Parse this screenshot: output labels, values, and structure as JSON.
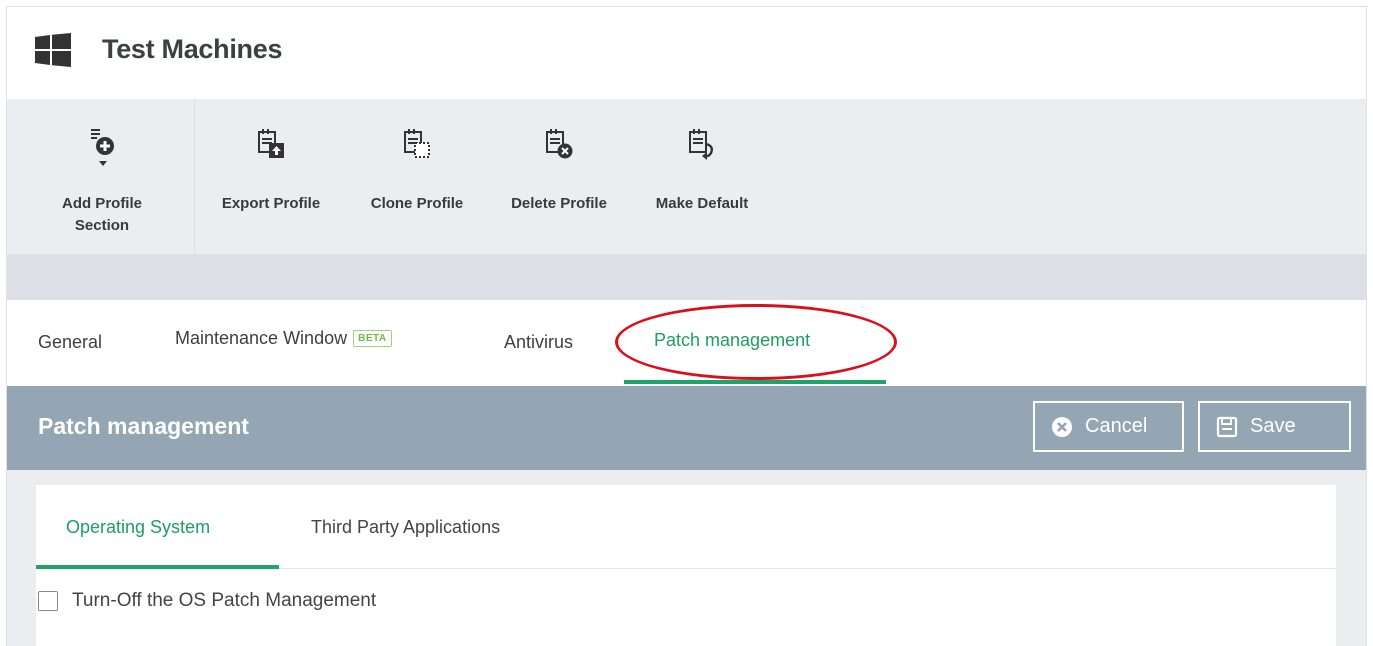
{
  "header": {
    "title": "Test Machines",
    "icon": "windows-logo"
  },
  "toolbar": {
    "buttons": [
      {
        "label": "Add Profile\nSection",
        "icon": "add-section-icon"
      },
      {
        "label": "Export Profile",
        "icon": "export-profile-icon"
      },
      {
        "label": "Clone Profile",
        "icon": "clone-profile-icon"
      },
      {
        "label": "Delete Profile",
        "icon": "delete-profile-icon"
      },
      {
        "label": "Make Default",
        "icon": "make-default-icon"
      }
    ]
  },
  "tabs": {
    "items": [
      {
        "label": "General"
      },
      {
        "label": "Maintenance Window",
        "badge": "BETA"
      },
      {
        "label": "Antivirus"
      },
      {
        "label": "Patch management",
        "active": true
      }
    ]
  },
  "section": {
    "title": "Patch management",
    "cancel_label": "Cancel",
    "save_label": "Save"
  },
  "subtabs": {
    "items": [
      {
        "label": "Operating System",
        "active": true
      },
      {
        "label": "Third Party Applications"
      }
    ]
  },
  "options": {
    "turn_off_label": "Turn-Off the OS Patch Management",
    "turn_off_checked": false
  },
  "colors": {
    "accent_green": "#1e9e63",
    "section_bar": "#94a5b3",
    "highlight_red": "#d9101b",
    "beta_green": "#6bbd45"
  }
}
